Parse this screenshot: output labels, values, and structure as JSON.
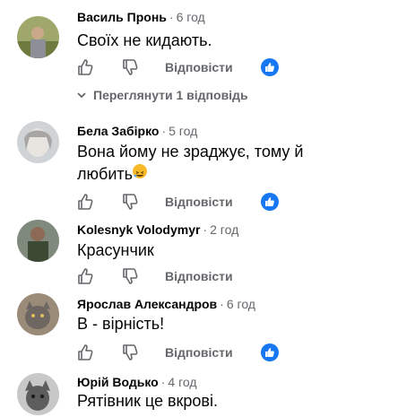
{
  "comments": [
    {
      "author": "Василь Пронь",
      "time": "6 год",
      "text": "Своїх не кидають.",
      "reply_label": "Відповісти"
    },
    {
      "author": "Бела Забірко",
      "time": "5 год",
      "text_line1": "Вона йому не зраджує, тому й",
      "text_line2": "любить",
      "reply_label": "Відповісти"
    },
    {
      "author": "Kolesnyk Volodymyr",
      "time": "2 год",
      "text": "Красунчик",
      "reply_label": "Відповісти"
    },
    {
      "author": "Ярослав Александров",
      "time": "6 год",
      "text": "В - вірність!",
      "reply_label": "Відповісти"
    },
    {
      "author": "Юрій Водько",
      "time": "4 год",
      "text": "Рятівник це вкрові."
    }
  ],
  "view_replies_label": "Переглянути 1 відповідь",
  "separator": "·",
  "colors": {
    "accent": "#1877f2",
    "secondary_text": "#65676b",
    "primary_text": "#050505"
  },
  "icons": {
    "like": "thumbs-up-outline-icon",
    "dislike": "thumbs-down-outline-icon",
    "like_reaction": "like-reaction-badge-icon",
    "emoji": "laughing-emoji-icon",
    "chevron": "chevron-down-icon"
  }
}
